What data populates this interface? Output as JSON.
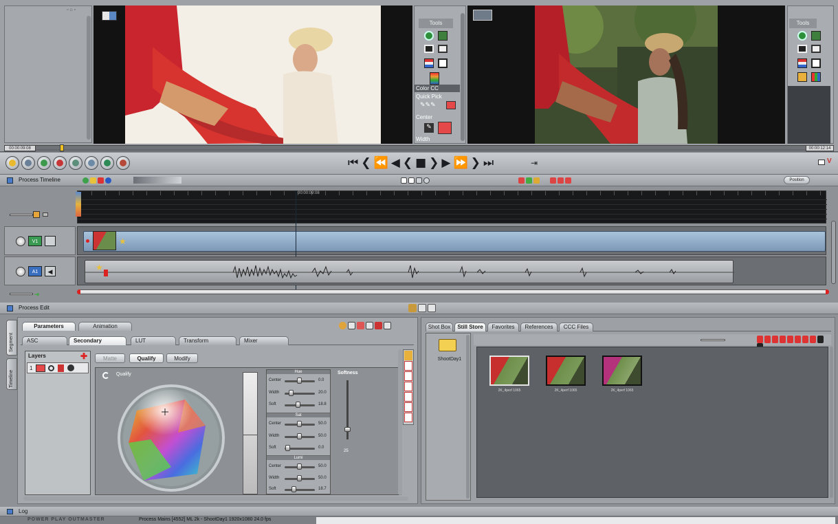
{
  "viewer": {
    "left_time": "00:00:09:08",
    "right_time": "00:00:12:14",
    "tools_label": "Tools",
    "tools_label_right": "Tools",
    "colorcc_label": "Color CC",
    "quickpick_label": "Quick Pick",
    "center_label": "Center",
    "width_label": "Width"
  },
  "timeline": {
    "title": "Process Timeline",
    "timecode": "00:00:09:08",
    "position_btn": "Position",
    "video_track": "V1",
    "audio_track": "A1"
  },
  "edit": {
    "title": "Process Edit",
    "tabs_top": [
      "Parameters",
      "Animation"
    ],
    "tabs_second": [
      "ASC",
      "Secondary",
      "LUT",
      "Transform",
      "Mixer"
    ],
    "side_tabs": [
      "Segment",
      "Timeline"
    ],
    "layers_label": "Layers",
    "layer_number": "1",
    "matte_btn": "Matte",
    "qualify_btn": "Qualify",
    "modify_btn": "Modify",
    "qualify_label": "Qualify",
    "softness_label": "Softness",
    "softness_value": "25",
    "hue": {
      "title": "Hue",
      "rows": [
        {
          "name": "Center",
          "value": "0.0"
        },
        {
          "name": "Width",
          "value": "20.0"
        },
        {
          "name": "Soft",
          "value": "18.8"
        }
      ]
    },
    "sat": {
      "title": "Sat",
      "rows": [
        {
          "name": "Center",
          "value": "50.0"
        },
        {
          "name": "Width",
          "value": "50.0"
        },
        {
          "name": "Soft",
          "value": "0.0"
        }
      ]
    },
    "lum": {
      "title": "Lumi",
      "rows": [
        {
          "name": "Center",
          "value": "50.0"
        },
        {
          "name": "Width",
          "value": "50.0"
        },
        {
          "name": "Soft",
          "value": "18.7"
        }
      ]
    }
  },
  "browser": {
    "tabs": [
      "Shot Box",
      "Still Store",
      "Favorites",
      "References",
      "CCC Files"
    ],
    "folder_label": "ShootDay1",
    "thumbs": [
      "2K_4perf 1065",
      "2K_4perf 1065",
      "2K_4perf 1065"
    ]
  },
  "log": {
    "title": "Log",
    "status_brand": "POWER PLAY OUTMASTER",
    "status_text": "Process  Mains [4552] ML  2k - ShootDay1  1920x1080  24.0 fps"
  },
  "colors": {
    "accent": "#e33b3b",
    "track_blue": "#7e9ab5",
    "selection": "#a8c7e6"
  }
}
